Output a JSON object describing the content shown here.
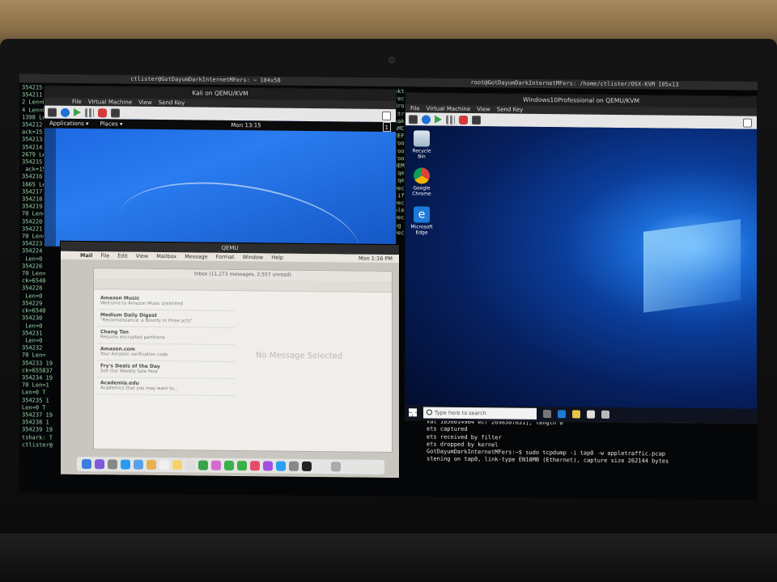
{
  "host": {
    "left_terminal_title": "ctlister@GotDayumDarkInternetMFers: ~ 104x58",
    "right_terminal_title": "root@GotDayumDarkInternetMFers: /home/ctlister/OSX-KVM 105x13",
    "left_terminal_lines": [
      "354215",
      "354211",
      "2 Len=0",
      "4 Len=0",
      "1398 Len=",
      "354212",
      "ack=15",
      "354213",
      "354214",
      "2679 Len=",
      "354215",
      " ack=15",
      "354216",
      "1665 Len=",
      "354217",
      "354218",
      "354219",
      "70 Len=",
      "354220",
      "354221",
      "70 Len=",
      "354223",
      "354224",
      " Len=0",
      "354226",
      "70 Len=",
      "ck=6540",
      "354228",
      " Len=0",
      "354229",
      "ck=6540",
      "354230",
      " Len=0",
      "354231",
      " Len=0",
      "354232",
      "70 Len=",
      "354233 19",
      "ck=655037",
      "354234 19",
      "70 Len=1",
      "Len=0 T",
      "354235 1",
      "Len=0 T",
      "354237 19",
      "354238 1",
      "354239 19",
      "tshark: T",
      "ctlister@"
    ],
    "right_terminal_top_lines": [
      "pkt",
      "rec",
      "dro",
      "str",
      "wak",
      "SMC",
      "WEF",
      "root",
      "root",
      "root",
      "QEMU",
      "[qen",
      "[qen",
      "Dec",
      "tifi",
      "Dec",
      "ble",
      "Dec",
      "ng s",
      "Dec"
    ],
    "right_terminal_bottom_lines": [
      "5365 IP 192.168.122.50.49503 > 0.40.223.211.imaps: Flags [.], ack 0754370, win 11692, options",
      "val 1056014964 ecr 2698307831], length 0",
      "",
      "ets captured",
      "ets received by filter",
      "ets dropped by kernel",
      "GotDayumDarkInternetMFers:~$ sudo tcpdump -i tap0 -w appletraffic.pcap",
      "stening on tap0, link-type EN10MB (Ethernet), capture size 262144 bytes"
    ]
  },
  "kali_window": {
    "title": "Kali on QEMU/KVM",
    "menu": [
      "File",
      "Virtual Machine",
      "View",
      "Send Key"
    ],
    "panel_applications": "Applications ▾",
    "panel_places": "Places ▾",
    "panel_clock": "Mon 13:15",
    "workspace_badge": "1"
  },
  "windows_window": {
    "title": "Windows10Professional on QEMU/KVM",
    "menu": [
      "File",
      "Virtual Machine",
      "View",
      "Send Key"
    ],
    "icons": [
      "Recycle Bin",
      "Google Chrome",
      "Microsoft Edge"
    ],
    "search_placeholder": "Type here to search"
  },
  "qemu_window": {
    "title": "QEMU",
    "menubar": [
      "Mail",
      "File",
      "Edit",
      "View",
      "Mailbox",
      "Message",
      "Format",
      "Window",
      "Help"
    ],
    "time": "Mon 1:16 PM",
    "mail_title": "Inbox (11,273 messages, 2,557 unread)",
    "messages": [
      {
        "from": "Amazon Music",
        "subject": "Welcome to Amazon Music Unlimited"
      },
      {
        "from": "Medium Daily Digest",
        "subject": "\"Reconnaissance: a Bounty in three acts\""
      },
      {
        "from": "Chang Tan",
        "subject": "Resume encrypted partitions"
      },
      {
        "from": "Amazon.com",
        "subject": "Your Amazon verification code"
      },
      {
        "from": "Fry's Deals of the Day",
        "subject": "See Our Weekly Sale Now"
      },
      {
        "from": "Academia.edu",
        "subject": "Academics that you may want to..."
      }
    ],
    "empty_pane": "No Message Selected"
  },
  "colors": {
    "terminal_green": "#9fd7a8",
    "kali_blue": "#2a7cf0",
    "win_blue": "#0b3d9a"
  }
}
